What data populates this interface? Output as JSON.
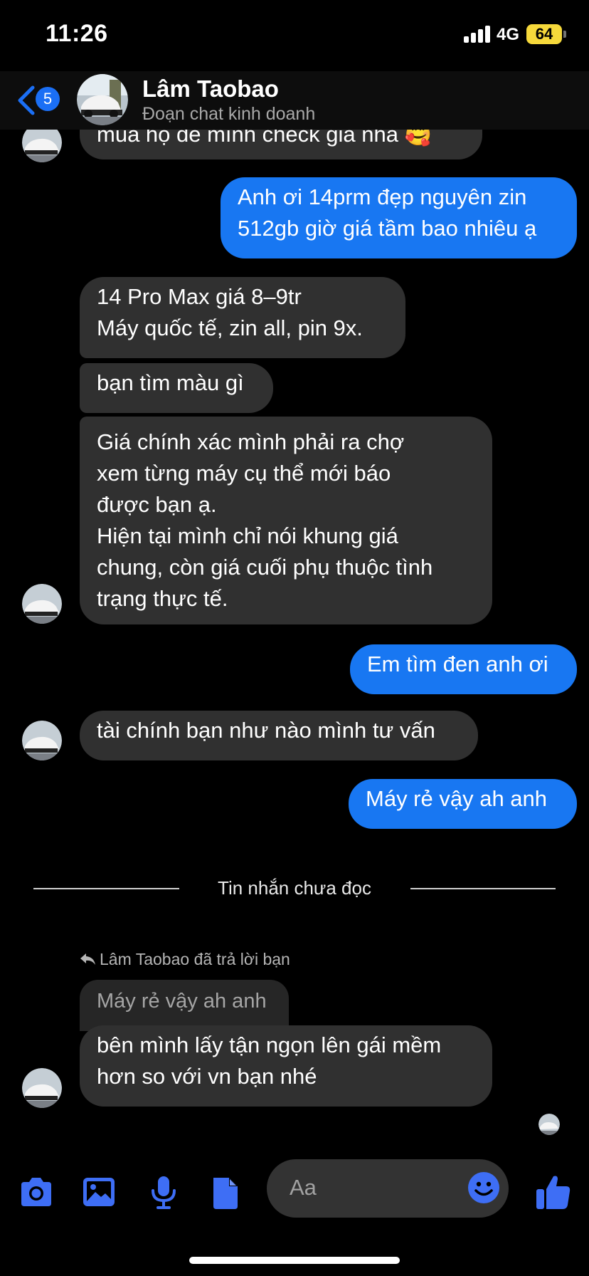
{
  "status_bar": {
    "time": "11:26",
    "network": "4G",
    "battery": "64"
  },
  "header": {
    "back_count": "5",
    "contact_name": "Lâm Taobao",
    "subtitle": "Đoạn chat kinh doanh"
  },
  "messages": {
    "cut_off": "mua họ để mình check giá nha 🥰",
    "m1": "Anh ơi 14prm đẹp nguyên zin\n512gb giờ giá tầm bao nhiêu ạ",
    "m2": "14 Pro Max giá 8–9tr\nMáy quốc tế, zin all, pin 9x.",
    "m3": "bạn tìm màu gì",
    "m4": "Giá chính xác mình phải ra chợ\nxem từng máy cụ thể mới báo\nđược bạn ạ.\nHiện tại mình chỉ nói khung giá\nchung, còn giá cuối phụ thuộc tình\ntrạng thực tế.",
    "m5": "Em tìm đen anh ơi",
    "m6": "tài chính bạn như nào mình tư vấn",
    "m7": "Máy rẻ vậy ah anh",
    "unread_divider": "Tin nhắn chưa đọc",
    "reply_label": "Lâm Taobao đã trả lời bạn",
    "quoted": "Máy rẻ vậy ah anh",
    "m8": "bên mình lấy tận ngọn lên gái mềm\nhơn so với vn bạn nhé"
  },
  "composer": {
    "placeholder": "Aa"
  },
  "colors": {
    "outgoing": "#1877f2",
    "incoming": "#303030",
    "icon_blue": "#3e6ef5",
    "badge": "#1b6ff5"
  }
}
